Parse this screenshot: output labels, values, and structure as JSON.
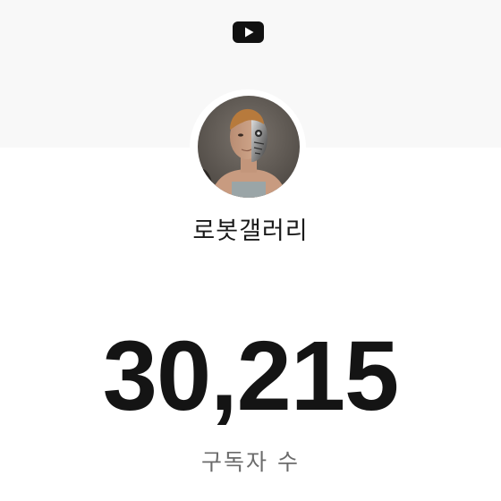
{
  "app": {
    "logo_icon": "youtube-icon",
    "brand_color": "#111111"
  },
  "channel": {
    "name": "로봇갤러리",
    "avatar": "cyborg-portrait"
  },
  "subscribers": {
    "count": "30,215",
    "label": "구독자 수"
  }
}
